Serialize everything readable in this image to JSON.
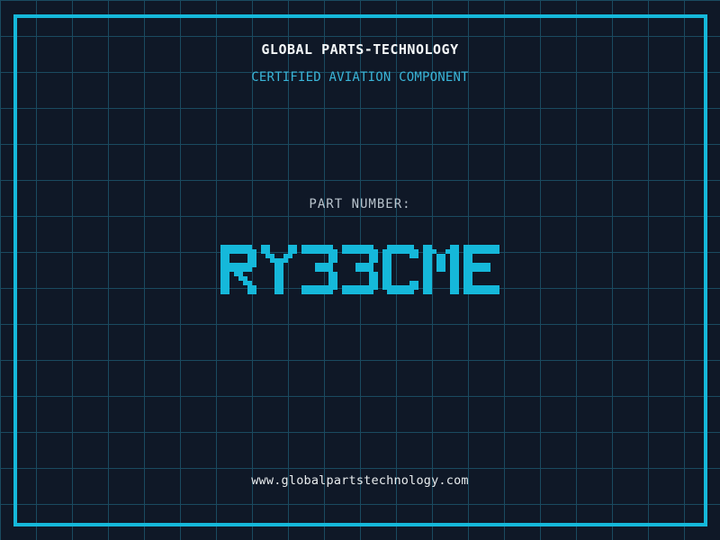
{
  "header": {
    "title": "GLOBAL PARTS-TECHNOLOGY",
    "subtitle": "CERTIFIED AVIATION COMPONENT"
  },
  "part": {
    "label": "PART NUMBER:",
    "number": "RY33CME"
  },
  "footer": {
    "website": "www.globalpartstechnology.com"
  },
  "colors": {
    "background": "#0f1827",
    "grid_line": "#1a4a60",
    "frame_and_part_cyan": "#15b8da",
    "subtitle_cyan": "#3ab5d8",
    "title_white": "#f4f7f8",
    "label_gray": "#b8c3cc",
    "website_white": "#e8ecee"
  }
}
